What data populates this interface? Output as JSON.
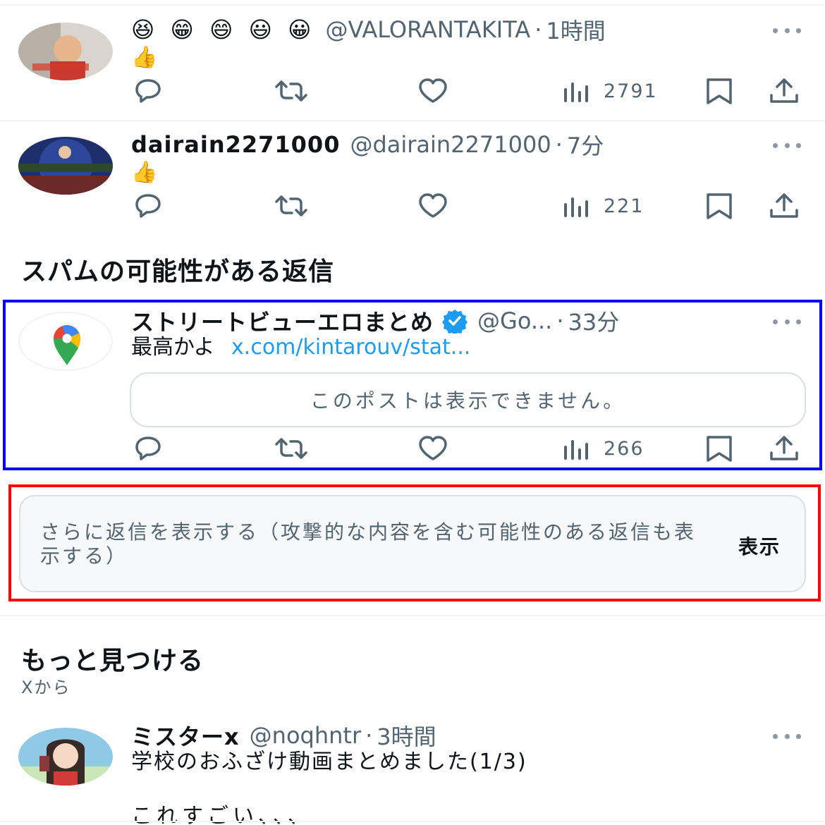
{
  "posts": [
    {
      "name": "😆 😁 😄 😃 😀",
      "handle": "@VALORANTAKITA",
      "dot": "·",
      "time": "1時間",
      "text": "👍",
      "views": "2791"
    },
    {
      "name": "dairain2271000",
      "handle": "@dairain2271000",
      "dot": "·",
      "time": "7分",
      "text": "👍",
      "views": "221"
    }
  ],
  "spam_section": {
    "title": "スパムの可能性がある返信",
    "post": {
      "name": "ストリートビューエロまとめ",
      "handle": "@Go...",
      "dot": "·",
      "time": "33分",
      "text": "最高かよ",
      "link": "x.com/kintarouv/stat...",
      "quote_unavailable": "このポストは表示できません。",
      "views": "266"
    }
  },
  "show_more": {
    "text": "さらに返信を表示する（攻撃的な内容を含む可能性のある返信も表示する）",
    "button": "表示"
  },
  "discover": {
    "title": "もっと見つける",
    "subtitle": "Xから",
    "post": {
      "name": "ミスターx",
      "handle": "@noqhntr",
      "dot": "·",
      "time": "3時間",
      "text": "学校のおふざけ動画まとめました(1/3)",
      "text2": "これすごい、、、"
    }
  },
  "colors": {
    "accent": "#1d9bf0",
    "muted": "#536471",
    "highlight_blue": "#0000ff",
    "highlight_red": "#ff0000"
  },
  "icons": [
    "reply-icon",
    "repost-icon",
    "like-icon",
    "views-icon",
    "bookmark-icon",
    "share-icon",
    "more-icon",
    "verified-icon",
    "google-maps-icon"
  ]
}
